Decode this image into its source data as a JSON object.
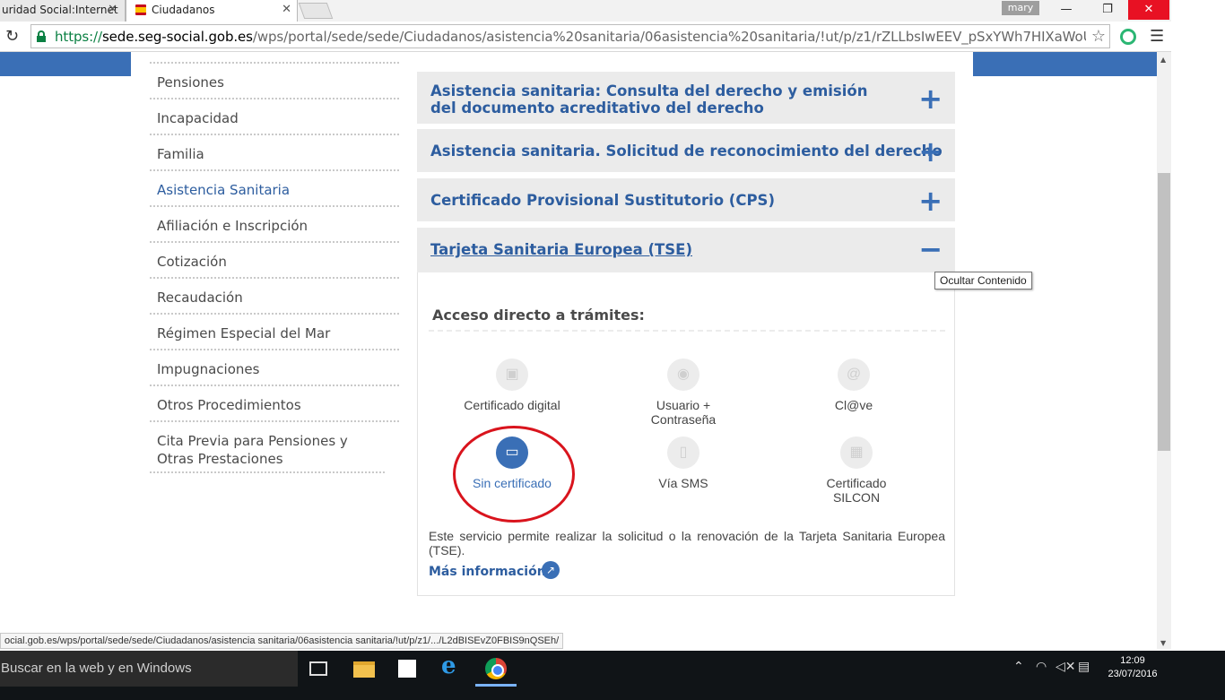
{
  "browser": {
    "tabs": [
      {
        "title": "uridad Social:Internet",
        "close": "✕"
      },
      {
        "title": "Ciudadanos",
        "close": "✕"
      }
    ],
    "user_badge": "mary",
    "url": {
      "protocol": "https://",
      "host": "sede.seg-social.gob.es",
      "path": "/wps/portal/sede/sede/Ciudadanos/asistencia%20sanitaria/06asistencia%20sanitaria/!ut/p/z1/rZLLbsIwEEV_pSxYWh7HIXaWoUIplBSFE"
    },
    "status_url": "ocial.gob.es/wps/portal/sede/sede/Ciudadanos/asistencia sanitaria/06asistencia sanitaria/!ut/p/z1/.../L2dBISEvZ0FBIS9nQSEh/"
  },
  "sidebar": {
    "items": [
      {
        "label": "Pensiones"
      },
      {
        "label": "Incapacidad"
      },
      {
        "label": "Familia"
      },
      {
        "label": "Asistencia Sanitaria"
      },
      {
        "label": "Afiliación e Inscripción"
      },
      {
        "label": "Cotización"
      },
      {
        "label": "Recaudación"
      },
      {
        "label": "Régimen Especial del Mar"
      },
      {
        "label": "Impugnaciones"
      },
      {
        "label": "Otros Procedimientos"
      },
      {
        "label": "Cita Previa para Pensiones y Otras Prestaciones"
      }
    ]
  },
  "accordion": [
    {
      "title": "Asistencia sanitaria: Consulta del derecho y emisión del documento acreditativo del derecho",
      "icon": "+"
    },
    {
      "title": "Asistencia sanitaria. Solicitud de reconocimiento del derecho",
      "icon": "+"
    },
    {
      "title": "Certificado Provisional Sustitutorio (CPS)",
      "icon": "+"
    },
    {
      "title": "Tarjeta Sanitaria Europea (TSE)",
      "icon": "−"
    }
  ],
  "tooltip": "Ocultar Contenido",
  "access": {
    "heading": "Acceso directo a trámites:",
    "options": [
      {
        "label": "Certificado digital"
      },
      {
        "label": "Usuario + Contraseña"
      },
      {
        "label": "Cl@ve"
      },
      {
        "label": "Sin certificado"
      },
      {
        "label": "Vía SMS"
      },
      {
        "label": "Certificado SILCON"
      }
    ],
    "description": "Este servicio permite realizar la solicitud o la renovación de la Tarjeta Sanitaria Europea (TSE).",
    "more_info": "Más información"
  },
  "taskbar": {
    "search_placeholder": "Buscar en la web y en Windows",
    "time": "12:09",
    "date": "23/07/2016"
  },
  "colors": {
    "brand_blue": "#3a6fb6",
    "link_blue": "#2d5d9f",
    "annotation_red": "#d9141d"
  }
}
